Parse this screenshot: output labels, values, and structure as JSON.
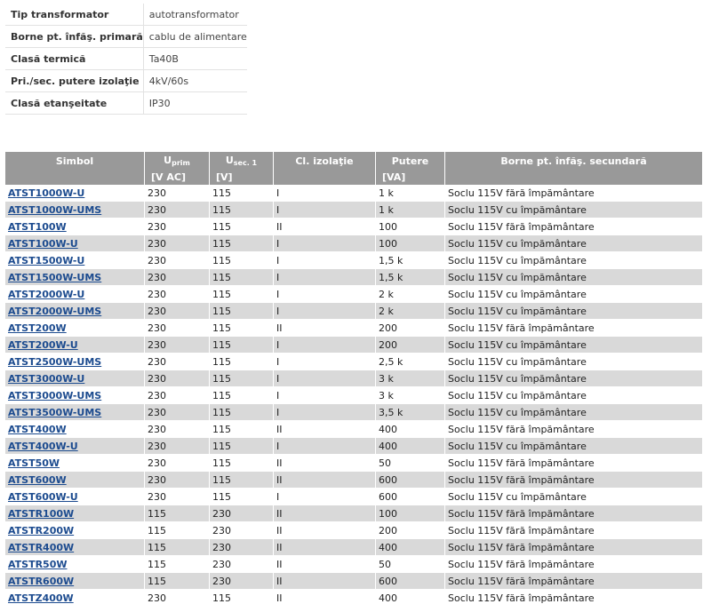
{
  "specs": [
    {
      "label": "Tip transformator",
      "value": "autotransformator"
    },
    {
      "label": "Borne pt. înfăş. primară",
      "value": "cablu de alimentare"
    },
    {
      "label": "Clasă termică",
      "value": "Ta40B"
    },
    {
      "label": "Pri./sec. putere izolaţie",
      "value": "4kV/60s"
    },
    {
      "label": "Clasă etanşeitate",
      "value": "IP30"
    }
  ],
  "table": {
    "headers": {
      "symbol": "Simbol",
      "u_prim_main": "U",
      "u_prim_sub": "prim",
      "u_sec_main": "U",
      "u_sec_sub": "sec. 1",
      "insulation": "Cl. izolaţie",
      "power": "Putere",
      "terminals": "Borne pt. înfăş. secundară"
    },
    "units": {
      "symbol": "",
      "u_prim": "[V AC]",
      "u_sec": "[V]",
      "insulation": "",
      "power": "[VA]",
      "terminals": ""
    },
    "rows": [
      [
        "ATST1000W-U",
        "230",
        "115",
        "I",
        "1 k",
        "Soclu 115V fără împământare"
      ],
      [
        "ATST1000W-UMS",
        "230",
        "115",
        "I",
        "1 k",
        "Soclu 115V cu împământare"
      ],
      [
        "ATST100W",
        "230",
        "115",
        "II",
        "100",
        "Soclu 115V fără împământare"
      ],
      [
        "ATST100W-U",
        "230",
        "115",
        "I",
        "100",
        "Soclu 115V cu împământare"
      ],
      [
        "ATST1500W-U",
        "230",
        "115",
        "I",
        "1,5 k",
        "Soclu 115V cu împământare"
      ],
      [
        "ATST1500W-UMS",
        "230",
        "115",
        "I",
        "1,5 k",
        "Soclu 115V cu împământare"
      ],
      [
        "ATST2000W-U",
        "230",
        "115",
        "I",
        "2 k",
        "Soclu 115V cu împământare"
      ],
      [
        "ATST2000W-UMS",
        "230",
        "115",
        "I",
        "2 k",
        "Soclu 115V cu împământare"
      ],
      [
        "ATST200W",
        "230",
        "115",
        "II",
        "200",
        "Soclu 115V fără împământare"
      ],
      [
        "ATST200W-U",
        "230",
        "115",
        "I",
        "200",
        "Soclu 115V cu împământare"
      ],
      [
        "ATST2500W-UMS",
        "230",
        "115",
        "I",
        "2,5 k",
        "Soclu 115V cu împământare"
      ],
      [
        "ATST3000W-U",
        "230",
        "115",
        "I",
        "3 k",
        "Soclu 115V cu împământare"
      ],
      [
        "ATST3000W-UMS",
        "230",
        "115",
        "I",
        "3 k",
        "Soclu 115V cu împământare"
      ],
      [
        "ATST3500W-UMS",
        "230",
        "115",
        "I",
        "3,5 k",
        "Soclu 115V cu împământare"
      ],
      [
        "ATST400W",
        "230",
        "115",
        "II",
        "400",
        "Soclu 115V fără împământare"
      ],
      [
        "ATST400W-U",
        "230",
        "115",
        "I",
        "400",
        "Soclu 115V cu împământare"
      ],
      [
        "ATST50W",
        "230",
        "115",
        "II",
        "50",
        "Soclu 115V fără împământare"
      ],
      [
        "ATST600W",
        "230",
        "115",
        "II",
        "600",
        "Soclu 115V fără împământare"
      ],
      [
        "ATST600W-U",
        "230",
        "115",
        "I",
        "600",
        "Soclu 115V cu împământare"
      ],
      [
        "ATSTR100W",
        "115",
        "230",
        "II",
        "100",
        "Soclu 115V fără împământare"
      ],
      [
        "ATSTR200W",
        "115",
        "230",
        "II",
        "200",
        "Soclu 115V fără împământare"
      ],
      [
        "ATSTR400W",
        "115",
        "230",
        "II",
        "400",
        "Soclu 115V fără împământare"
      ],
      [
        "ATSTR50W",
        "115",
        "230",
        "II",
        "50",
        "Soclu 115V fără împământare"
      ],
      [
        "ATSTR600W",
        "115",
        "230",
        "II",
        "600",
        "Soclu 115V fără împământare"
      ],
      [
        "ATSTZ400W",
        "230",
        "115",
        "II",
        "400",
        "Soclu 115V fără împământare"
      ]
    ]
  },
  "colors": {
    "header_bg": "#999999",
    "stripe": "#d9d9d9",
    "link": "#1c4b8f"
  }
}
